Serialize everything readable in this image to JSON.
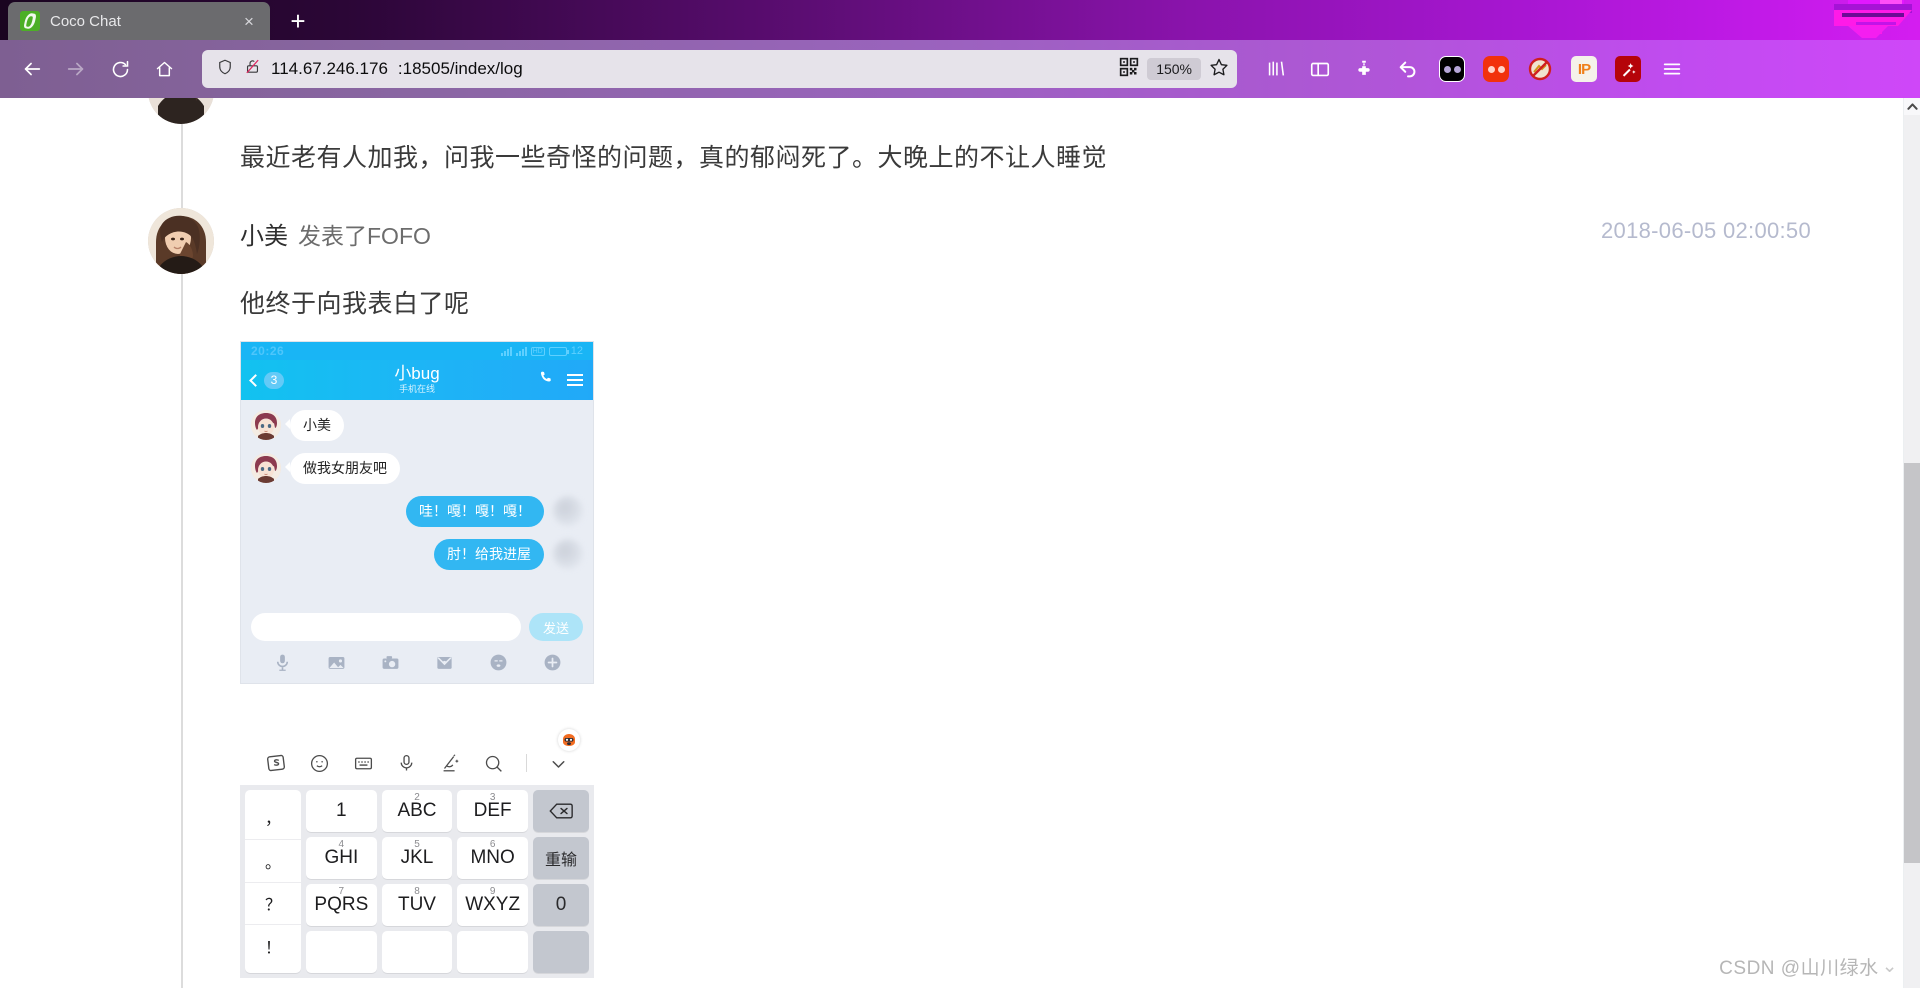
{
  "browser": {
    "tab": {
      "title": "Coco Chat",
      "favicon": "leaf-icon",
      "close": "×"
    },
    "newtab_label": "+",
    "nav": {
      "back": "←",
      "forward": "→",
      "reload": "⟳",
      "home": "⌂"
    },
    "url": {
      "host": "114.67.246.176",
      "path": ":18505/index/log",
      "shield_icon": "shield-icon",
      "lock_broken_icon": "lock-broken-icon",
      "qr_icon": "qr-code-icon",
      "zoom_level": "150%",
      "bookmark_icon": "star-icon"
    },
    "toolbar_icons": [
      {
        "name": "library-icon",
        "glyph": "|||\\"
      },
      {
        "name": "sidebar-icon",
        "glyph": "▯"
      },
      {
        "name": "extensions-puzzle-icon",
        "glyph": "✥"
      },
      {
        "name": "undo-close-tab-icon",
        "glyph": "↩"
      },
      {
        "name": "pocket-icon",
        "glyph": ""
      },
      {
        "name": "red-extension-icon",
        "glyph": ""
      },
      {
        "name": "adblock-disabled-icon",
        "glyph": "⊘"
      },
      {
        "name": "ip-extension-icon",
        "glyph": "IP"
      },
      {
        "name": "magic-wand-extension-icon",
        "glyph": "✨"
      },
      {
        "name": "app-menu-icon",
        "glyph": "☰"
      }
    ]
  },
  "feed": {
    "entries": [
      {
        "id": "entry-1",
        "body": "最近老有人加我，问我一些奇怪的问题，真的郁闷死了。大晚上的不让人睡觉"
      },
      {
        "id": "entry-2",
        "author": "小美",
        "action": "发表了FOFO",
        "time": "2018-06-05 02:00:50",
        "body": "他终于向我表白了呢"
      }
    ]
  },
  "phone": {
    "status": {
      "clock": "20:26",
      "battery": "12",
      "hd_label": "HD"
    },
    "header": {
      "back_badge": "3",
      "title": "小bug",
      "subtitle": "手机在线",
      "call_icon": "phone-call-icon",
      "menu_icon": "hamburger-menu-icon"
    },
    "messages": [
      {
        "side": "left",
        "text": "小美"
      },
      {
        "side": "left",
        "text": "做我女朋友吧"
      },
      {
        "side": "right",
        "text": "哇！嘎！嘎！嘎！"
      },
      {
        "side": "right",
        "text": "肘！给我进屋"
      }
    ],
    "input": {
      "value": "",
      "placeholder": "",
      "send_label": "发送"
    },
    "tools": [
      {
        "name": "microphone-icon"
      },
      {
        "name": "image-icon"
      },
      {
        "name": "camera-icon"
      },
      {
        "name": "envelope-icon"
      },
      {
        "name": "emoji-icon"
      },
      {
        "name": "plus-icon"
      }
    ]
  },
  "ime": {
    "badge_icon": "sogou-mascot-icon",
    "toolbar": [
      {
        "name": "sogou-logo-icon",
        "glyph": "S"
      },
      {
        "name": "emoji-icon",
        "glyph": "☺"
      },
      {
        "name": "keyboard-icon",
        "glyph": "⌨"
      },
      {
        "name": "microphone-icon",
        "glyph": "🎤"
      },
      {
        "name": "handwriting-icon",
        "glyph": "✍"
      },
      {
        "name": "search-icon",
        "glyph": "🔍"
      },
      {
        "name": "collapse-keyboard-icon",
        "glyph": "⌄"
      }
    ],
    "punctuation": [
      "，",
      "。",
      "？",
      "！"
    ],
    "keys": [
      {
        "sup": "",
        "label": "1",
        "type": "num"
      },
      {
        "sup": "2",
        "label": "ABC",
        "type": "num"
      },
      {
        "sup": "3",
        "label": "DEF",
        "type": "num"
      },
      {
        "sup": "",
        "label": "⌫",
        "type": "fn",
        "name": "backspace-key"
      },
      {
        "sup": "4",
        "label": "GHI",
        "type": "num"
      },
      {
        "sup": "5",
        "label": "JKL",
        "type": "num"
      },
      {
        "sup": "6",
        "label": "MNO",
        "type": "num"
      },
      {
        "sup": "",
        "label": "重输",
        "type": "fn",
        "name": "retype-key"
      },
      {
        "sup": "7",
        "label": "PQRS",
        "type": "num"
      },
      {
        "sup": "8",
        "label": "TUV",
        "type": "num"
      },
      {
        "sup": "9",
        "label": "WXYZ",
        "type": "num"
      },
      {
        "sup": "",
        "label": "0",
        "type": "fn",
        "name": "zero-key"
      }
    ]
  },
  "scrollbar": {
    "up_arrow": "^"
  },
  "watermark": {
    "text": "CSDN @山川绿水"
  },
  "colors": {
    "titlebar_purple": "#8a13ac",
    "navbar_purple": "#9a63bd",
    "phone_blue": "#1eb4f6",
    "bubble_blue": "#32b7f2",
    "timestamp_gray": "#b5bace"
  }
}
